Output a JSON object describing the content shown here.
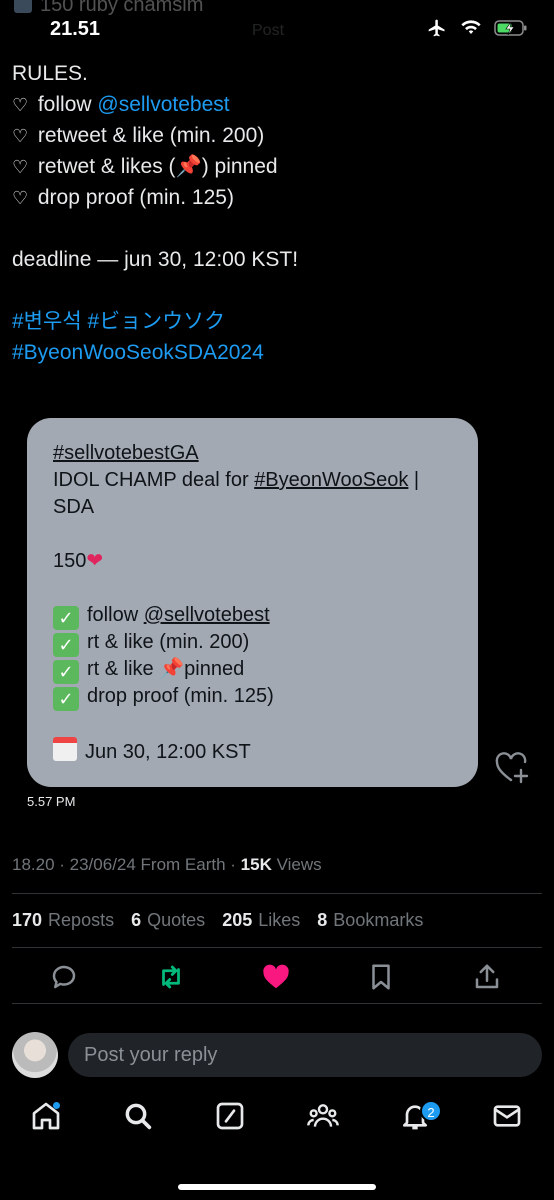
{
  "status_bar": {
    "time": "21.51",
    "ghost_title": "150 ruby chamsim",
    "ghost_label": "Post"
  },
  "tweet": {
    "rules_title": "RULES.",
    "rules": [
      {
        "prefix": "follow ",
        "link": "@sellvotebest",
        "suffix": ""
      },
      {
        "prefix": "retweet & like (min. 200)",
        "link": "",
        "suffix": ""
      },
      {
        "prefix": "retwet & likes (",
        "link": "",
        "suffix": ") pinned"
      },
      {
        "prefix": "drop proof (min. 125)",
        "link": "",
        "suffix": ""
      }
    ],
    "deadline": "deadline — jun 30, 12:00 KST!",
    "hashtag_line1": "#변우석 #ビョンウソク",
    "hashtag_line2": "#ByeonWooSeokSDA2024"
  },
  "card": {
    "hashtag": "#sellvotebestGA",
    "line1_prefix": "IDOL CHAMP deal for ",
    "line1_link": "#ByeonWooSeok",
    "line1_suffix": " |",
    "line2": "SDA",
    "prize": "150",
    "items": [
      {
        "prefix": "follow ",
        "link": "@sellvotebest",
        "suffix": ""
      },
      {
        "prefix": "rt & like (min. 200)",
        "link": "",
        "suffix": ""
      },
      {
        "prefix": "rt & like ",
        "link": "",
        "suffix": "pinned"
      },
      {
        "prefix": "drop proof (min. 125)",
        "link": "",
        "suffix": ""
      }
    ],
    "date": "Jun 30, 12:00 KST",
    "timestamp": "5.57 PM"
  },
  "meta": {
    "time_date": "18.20 · 23/06/24 From Earth · ",
    "views_count": "15K",
    "views_label": " Views"
  },
  "stats": {
    "reposts_count": "170",
    "reposts_label": "Reposts",
    "quotes_count": "6",
    "quotes_label": "Quotes",
    "likes_count": "205",
    "likes_label": "Likes",
    "bookmarks_count": "8",
    "bookmarks_label": "Bookmarks"
  },
  "reply": {
    "placeholder": "Post your reply"
  },
  "tabbar": {
    "notification_count": "2"
  },
  "colors": {
    "link": "#1d9bf0",
    "retweet_active": "#00ba7c",
    "like_active": "#f91880",
    "card_bg": "#a2a9b2"
  }
}
